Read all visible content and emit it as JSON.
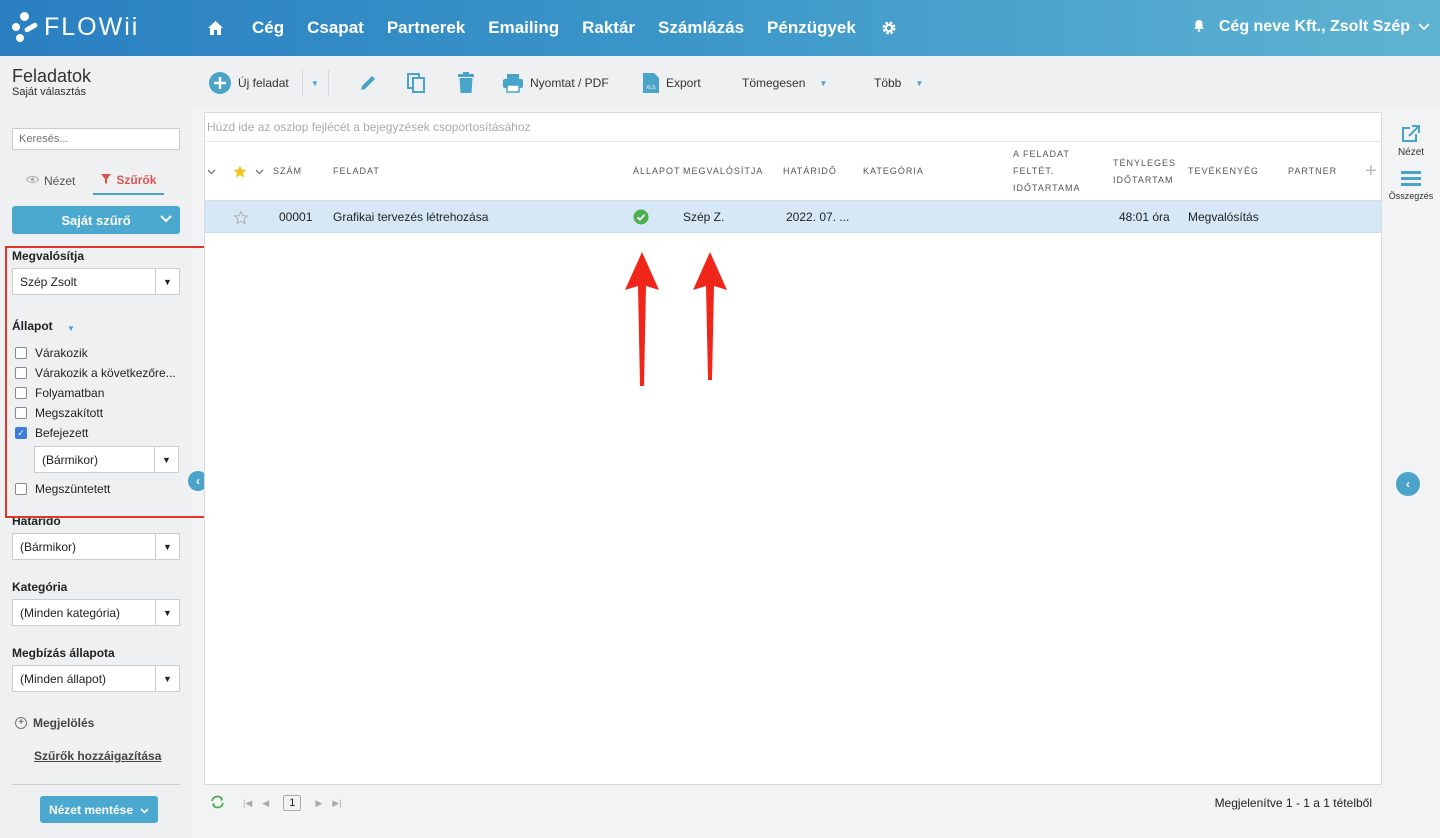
{
  "brand": {
    "name": "FLOWii"
  },
  "nav": {
    "items": [
      "Cég",
      "Csapat",
      "Partnerek",
      "Emailing",
      "Raktár",
      "Számlázás",
      "Pénzügyek"
    ],
    "account": "Cég neve Kft., Zsolt Szép"
  },
  "page": {
    "title": "Feladatok",
    "subtitle": "Saját választás"
  },
  "sidebar": {
    "search_placeholder": "Keresés...",
    "tab_view": "Nézet",
    "tab_filters": "Szűrők",
    "own_filter": "Saját szűrő",
    "assignee_label": "Megvalósítja",
    "assignee_value": "Szép Zsolt",
    "status_label": "Állapot",
    "statuses": [
      {
        "label": "Várakozik",
        "checked": false
      },
      {
        "label": "Várakozik a következőre...",
        "checked": false
      },
      {
        "label": "Folyamatban",
        "checked": false
      },
      {
        "label": "Megszakított",
        "checked": false
      },
      {
        "label": "Befejezett",
        "checked": true
      },
      {
        "label": "Megszüntetett",
        "checked": false
      }
    ],
    "completed_when": "(Bármikor)",
    "deadline_label": "Határidő",
    "deadline_value": "(Bármikor)",
    "category_label": "Kategória",
    "category_value": "(Minden kategória)",
    "assignment_label": "Megbízás állapota",
    "assignment_value": "(Minden állapot)",
    "marking": "Megjelölés",
    "assign_filters": "Szűrők hozzáigazítása",
    "save_view": "Nézet mentése"
  },
  "toolbar": {
    "new_task": "Új feladat",
    "print": "Nyomtat / PDF",
    "export": "Export",
    "bulk": "Tömegesen",
    "more": "Több"
  },
  "grid": {
    "group_hint": "Húzd ide az oszlop fejlécét a bejegyzések csoportosításához",
    "headers": {
      "number": "SZÁM",
      "task": "FELADAT",
      "status": "ÁLLAPOT",
      "assignee": "MEGVALÓSÍTJA",
      "deadline": "HATÁRIDŐ",
      "category": "KATEGÓRIA",
      "planned_1": "A FELADAT",
      "planned_2": "FELTÉT.",
      "planned_3": "IDŐTARTAMA",
      "actual_1": "TÉNYLEGES",
      "actual_2": "IDŐTARTAM",
      "activity": "TEVÉKENYÉG",
      "partner": "PARTNER"
    },
    "rows": [
      {
        "number": "00001",
        "task": "Grafikai tervezés létrehozása",
        "status": "completed",
        "assignee": "Szép Z.",
        "deadline": "2022. 07. ...",
        "category": "",
        "planned": "",
        "actual": "48:01 óra",
        "activity": "Megvalósítás",
        "partner": ""
      }
    ]
  },
  "pager": {
    "page": "1",
    "info": "Megjelenítve 1 - 1 a 1 tételből"
  },
  "right": {
    "view": "Nézet",
    "summary": "Összegzés"
  },
  "colors": {
    "accent": "#4ba8ce",
    "selected_row": "#d6e8f5",
    "highlight": "#e0362b",
    "success": "#4caf50"
  }
}
